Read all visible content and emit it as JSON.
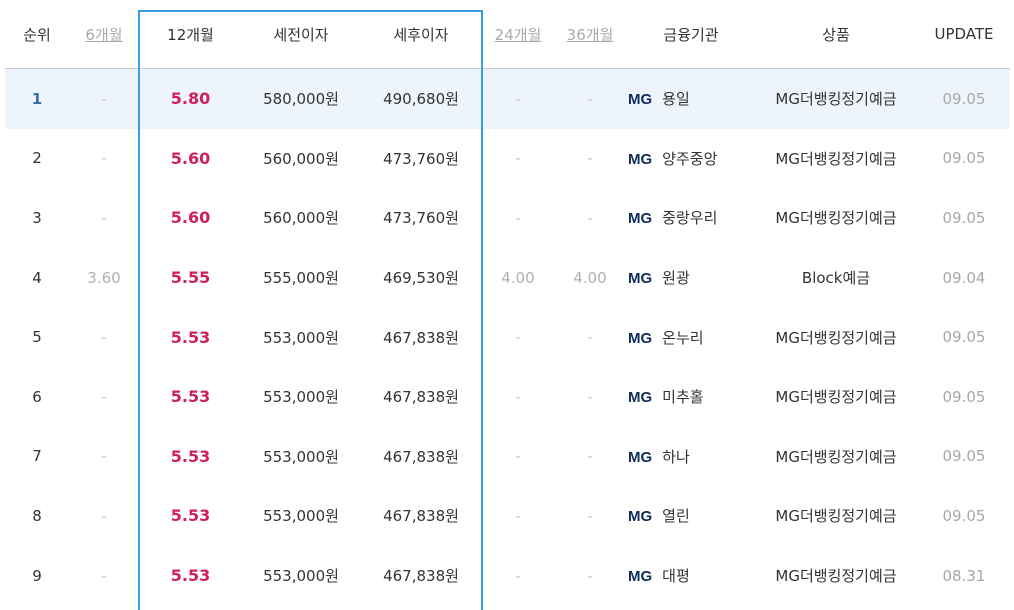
{
  "headers": {
    "rank": "순위",
    "m6": "6개월",
    "m12": "12개월",
    "pretax": "세전이자",
    "posttax": "세후이자",
    "m24": "24개월",
    "m36": "36개월",
    "institution": "금융기관",
    "product": "상품",
    "update": "UPDATE"
  },
  "brand_prefix": "MG",
  "colors": {
    "rate12": "#d0205a",
    "highlight_border": "#3a9de0",
    "row_highlight": "#eef4fb",
    "mg_brand": "#0f2d59"
  },
  "rows": [
    {
      "rank": "1",
      "m6": "-",
      "m12": "5.80",
      "pretax": "580,000원",
      "posttax": "490,680원",
      "m24": "-",
      "m36": "-",
      "institution": "용일",
      "product": "MG더뱅킹정기예금",
      "update": "09.05"
    },
    {
      "rank": "2",
      "m6": "-",
      "m12": "5.60",
      "pretax": "560,000원",
      "posttax": "473,760원",
      "m24": "-",
      "m36": "-",
      "institution": "양주중앙",
      "product": "MG더뱅킹정기예금",
      "update": "09.05"
    },
    {
      "rank": "3",
      "m6": "-",
      "m12": "5.60",
      "pretax": "560,000원",
      "posttax": "473,760원",
      "m24": "-",
      "m36": "-",
      "institution": "중랑우리",
      "product": "MG더뱅킹정기예금",
      "update": "09.05"
    },
    {
      "rank": "4",
      "m6": "3.60",
      "m12": "5.55",
      "pretax": "555,000원",
      "posttax": "469,530원",
      "m24": "4.00",
      "m36": "4.00",
      "institution": "원광",
      "product": "Block예금",
      "update": "09.04"
    },
    {
      "rank": "5",
      "m6": "-",
      "m12": "5.53",
      "pretax": "553,000원",
      "posttax": "467,838원",
      "m24": "-",
      "m36": "-",
      "institution": "온누리",
      "product": "MG더뱅킹정기예금",
      "update": "09.05"
    },
    {
      "rank": "6",
      "m6": "-",
      "m12": "5.53",
      "pretax": "553,000원",
      "posttax": "467,838원",
      "m24": "-",
      "m36": "-",
      "institution": "미추홀",
      "product": "MG더뱅킹정기예금",
      "update": "09.05"
    },
    {
      "rank": "7",
      "m6": "-",
      "m12": "5.53",
      "pretax": "553,000원",
      "posttax": "467,838원",
      "m24": "-",
      "m36": "-",
      "institution": "하나",
      "product": "MG더뱅킹정기예금",
      "update": "09.05"
    },
    {
      "rank": "8",
      "m6": "-",
      "m12": "5.53",
      "pretax": "553,000원",
      "posttax": "467,838원",
      "m24": "-",
      "m36": "-",
      "institution": "열린",
      "product": "MG더뱅킹정기예금",
      "update": "09.05"
    },
    {
      "rank": "9",
      "m6": "-",
      "m12": "5.53",
      "pretax": "553,000원",
      "posttax": "467,838원",
      "m24": "-",
      "m36": "-",
      "institution": "대평",
      "product": "MG더뱅킹정기예금",
      "update": "08.31"
    }
  ]
}
